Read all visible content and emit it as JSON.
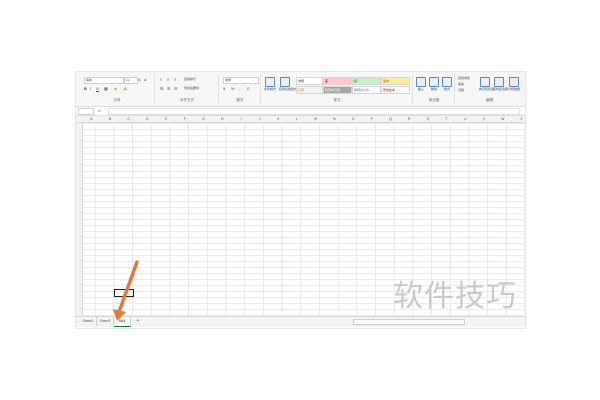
{
  "ribbon": {
    "font": {
      "name": "等线",
      "size": "11"
    },
    "number_format": "常规",
    "groups": [
      {
        "label": "字体"
      },
      {
        "label": "对齐方式"
      },
      {
        "label": "数字"
      },
      {
        "label": "样式"
      },
      {
        "label": "单元格"
      },
      {
        "label": "编辑"
      }
    ],
    "cell_styles": [
      "常规",
      "差",
      "好",
      "适中",
      "计算",
      "检查单元格",
      "解释性文本",
      "警告文本"
    ],
    "big_buttons": [
      "条件格式",
      "套用表格格式",
      "插入",
      "删除",
      "格式",
      "排序和筛选",
      "查找和选择",
      "分析数据"
    ],
    "small_items": [
      "自动换行",
      "合并后居中",
      "自动求和",
      "填充",
      "清除"
    ]
  },
  "formula_bar": {
    "fx_label": "fx"
  },
  "columns": [
    "A",
    "B",
    "C",
    "D",
    "E",
    "F",
    "G",
    "H",
    "I",
    "J",
    "K",
    "L",
    "M",
    "N",
    "O",
    "P",
    "Q",
    "R",
    "S",
    "T",
    "U",
    "V",
    "W",
    "X"
  ],
  "sheets": {
    "tabs": [
      "Sheet1",
      "Sheet2",
      "Sh3"
    ],
    "active_index": 2,
    "add_label": "+"
  },
  "watermark": "软件技巧",
  "colors": {
    "accent_green": "#1f6e3c",
    "annotation_arrow": "#e07a3a"
  }
}
